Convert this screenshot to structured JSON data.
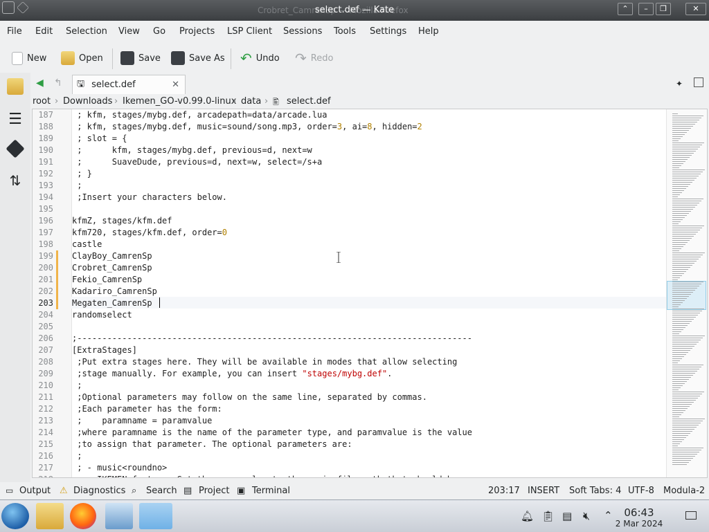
{
  "window": {
    "title": "select.def — Kate",
    "ghost_title": "Crobret_CamrenSp — Mozilla Firefox",
    "buttons": [
      "keep-above",
      "minimize",
      "maximize",
      "close"
    ]
  },
  "menu": [
    "File",
    "Edit",
    "Selection",
    "View",
    "Go",
    "Projects",
    "LSP Client",
    "Sessions",
    "Tools",
    "Settings",
    "Help"
  ],
  "toolbar": {
    "new": "New",
    "open": "Open",
    "save": "Save",
    "save_as": "Save As",
    "undo": "Undo",
    "redo": "Redo"
  },
  "tab": {
    "label": "select.def"
  },
  "breadcrumb": [
    "root",
    "Downloads",
    "Ikemen_GO-v0.99.0-linux",
    "data",
    "select.def"
  ],
  "editor": {
    "lines": [
      {
        "n": "187",
        "t": " ; kfm, stages/mybg.def, arcadepath=data/arcade.lua"
      },
      {
        "n": "188",
        "t": " ; kfm, stages/mybg.def, music=sound/song.mp3, order=3, ai=8, hidden=2"
      },
      {
        "n": "189",
        "t": " ; slot = {"
      },
      {
        "n": "190",
        "t": " ;      kfm, stages/mybg.def, previous=d, next=w"
      },
      {
        "n": "191",
        "t": " ;      SuaveDude, previous=d, next=w, select=/s+a"
      },
      {
        "n": "192",
        "t": " ; }"
      },
      {
        "n": "193",
        "t": " ;"
      },
      {
        "n": "194",
        "t": " ;Insert your characters below."
      },
      {
        "n": "195",
        "t": ""
      },
      {
        "n": "196",
        "t": "kfmZ, stages/kfm.def"
      },
      {
        "n": "197",
        "t": "kfm720, stages/kfm.def, order=0"
      },
      {
        "n": "198",
        "t": "castle"
      },
      {
        "n": "199",
        "t": "ClayBoy_CamrenSp"
      },
      {
        "n": "200",
        "t": "Crobret_CamrenSp"
      },
      {
        "n": "201",
        "t": "Fekio_CamrenSp"
      },
      {
        "n": "202",
        "t": "Kadariro_CamrenSp"
      },
      {
        "n": "203",
        "t": "Megaten_CamrenSp"
      },
      {
        "n": "204",
        "t": "randomselect"
      },
      {
        "n": "205",
        "t": ""
      },
      {
        "n": "206",
        "t": ";-------------------------------------------------------------------------------"
      },
      {
        "n": "207",
        "t": "[ExtraStages]"
      },
      {
        "n": "208",
        "t": " ;Put extra stages here. They will be available in modes that allow selecting"
      },
      {
        "n": "209",
        "t": " ;stage manually. For example, you can insert \"stages/mybg.def\"."
      },
      {
        "n": "210",
        "t": " ;"
      },
      {
        "n": "211",
        "t": " ;Optional parameters may follow on the same line, separated by commas."
      },
      {
        "n": "212",
        "t": " ;Each parameter has the form:"
      },
      {
        "n": "213",
        "t": " ;    paramname = paramvalue"
      },
      {
        "n": "214",
        "t": " ;where paramname is the name of the parameter type, and paramvalue is the value"
      },
      {
        "n": "215",
        "t": " ;to assign that parameter. The optional parameters are:"
      },
      {
        "n": "216",
        "t": " ;"
      },
      {
        "n": "217",
        "t": " ; - music<roundno>"
      },
      {
        "n": "218",
        "t": " ;   IKEMEN feature: Set the paramvalue to the music file path that should be"
      }
    ],
    "modified_lines": [
      "199",
      "200",
      "201",
      "202",
      "203"
    ],
    "current_line": "203"
  },
  "statusbar": {
    "output": "Output",
    "diagnostics": "Diagnostics",
    "search": "Search",
    "project": "Project",
    "terminal": "Terminal",
    "position": "203:17",
    "mode": "INSERT",
    "tabs": "Soft Tabs: 4",
    "encoding": "UTF-8",
    "syntax": "Modula-2"
  },
  "taskbar": {
    "time": "06:43",
    "date": "2 Mar 2024"
  },
  "colors": {
    "accent": "#3daee9",
    "number": "#b08000",
    "string": "#bf0303",
    "modified": "#f0b44a"
  }
}
